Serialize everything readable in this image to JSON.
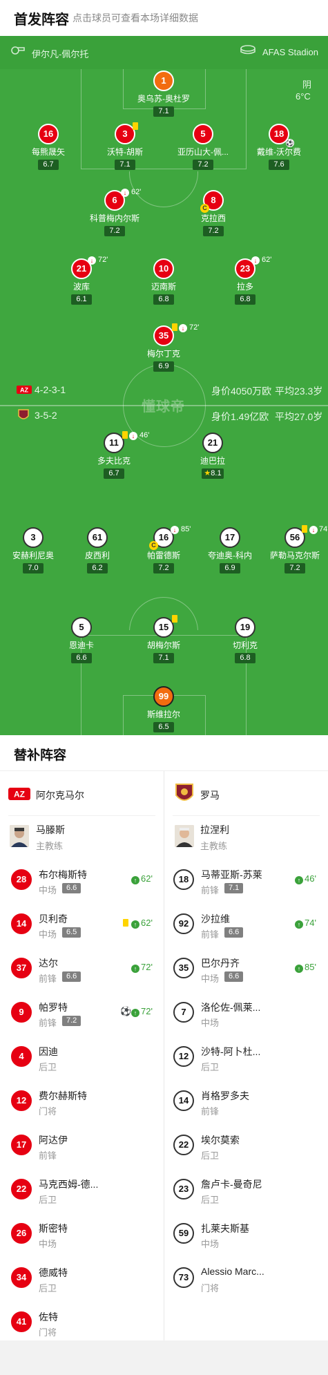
{
  "header": {
    "title": "首发阵容",
    "subtitle": "点击球员可查看本场详细数据"
  },
  "match": {
    "referee": "伊尔凡-佩尔托",
    "stadium": "AFAS Stadion",
    "weather": "阴",
    "temperature": "6°C"
  },
  "home": {
    "formation": "4-2-3-1",
    "value": "身价4050万欧",
    "avg_age": "平均23.3岁"
  },
  "away": {
    "formation": "3-5-2",
    "value": "身价1.49亿欧",
    "avg_age": "平均27.0岁"
  },
  "watermark": "懂球帝",
  "home_players": [
    {
      "num": "1",
      "name": "奥乌苏-奥杜罗",
      "rating": "7.1"
    },
    {
      "num": "16",
      "name": "每熊晟矢",
      "rating": "6.7"
    },
    {
      "num": "3",
      "name": "沃特-胡斯",
      "rating": "7.1"
    },
    {
      "num": "5",
      "name": "亚历山大-佩...",
      "rating": "7.2"
    },
    {
      "num": "18",
      "name": "戴维-沃尔费",
      "rating": "7.6"
    },
    {
      "num": "6",
      "name": "科普梅内尔斯",
      "rating": "7.2",
      "sub": "62'"
    },
    {
      "num": "8",
      "name": "克拉西",
      "rating": "7.2"
    },
    {
      "num": "21",
      "name": "波库",
      "rating": "6.1",
      "sub": "72'"
    },
    {
      "num": "10",
      "name": "迈南斯",
      "rating": "6.8"
    },
    {
      "num": "23",
      "name": "拉多",
      "rating": "6.8",
      "sub": "62'"
    },
    {
      "num": "35",
      "name": "梅尔丁克",
      "rating": "6.9",
      "sub": "72'"
    }
  ],
  "away_players": [
    {
      "num": "11",
      "name": "多夫比克",
      "rating": "6.7",
      "sub": "46'"
    },
    {
      "num": "21",
      "name": "迪巴拉",
      "rating": "8.1"
    },
    {
      "num": "3",
      "name": "安赫利尼奥",
      "rating": "7.0"
    },
    {
      "num": "61",
      "name": "皮西利",
      "rating": "6.2"
    },
    {
      "num": "16",
      "name": "帕雷德斯",
      "rating": "7.2",
      "sub": "85'"
    },
    {
      "num": "17",
      "name": "夸迪奥-科内",
      "rating": "6.9"
    },
    {
      "num": "56",
      "name": "萨勒马克尔斯",
      "rating": "7.2",
      "sub": "74'"
    },
    {
      "num": "5",
      "name": "恩迪卡",
      "rating": "6.6"
    },
    {
      "num": "15",
      "name": "胡梅尔斯",
      "rating": "7.1"
    },
    {
      "num": "19",
      "name": "切利克",
      "rating": "6.8"
    },
    {
      "num": "99",
      "name": "斯维拉尔",
      "rating": "6.5"
    }
  ],
  "subs": {
    "title": "替补阵容",
    "home_team": "阿尔克马尔",
    "away_team": "罗马",
    "home_coach": {
      "name": "马滕斯",
      "role": "主教练"
    },
    "away_coach": {
      "name": "拉涅利",
      "role": "主教练"
    },
    "home_list": [
      {
        "num": "28",
        "name": "布尔梅斯特",
        "pos": "中场",
        "rating": "6.6",
        "sub": "62'"
      },
      {
        "num": "14",
        "name": "贝利奇",
        "pos": "中场",
        "rating": "6.5",
        "sub": "62'"
      },
      {
        "num": "37",
        "name": "达尔",
        "pos": "前锋",
        "rating": "6.6",
        "sub": "72'"
      },
      {
        "num": "9",
        "name": "帕罗特",
        "pos": "前锋",
        "rating": "7.2",
        "sub": "72'"
      },
      {
        "num": "4",
        "name": "因迪",
        "pos": "后卫"
      },
      {
        "num": "12",
        "name": "费尔赫斯特",
        "pos": "门将"
      },
      {
        "num": "17",
        "name": "阿达伊",
        "pos": "前锋"
      },
      {
        "num": "22",
        "name": "马克西姆-德...",
        "pos": "后卫"
      },
      {
        "num": "26",
        "name": "斯密特",
        "pos": "中场"
      },
      {
        "num": "34",
        "name": "德威特",
        "pos": "后卫"
      },
      {
        "num": "41",
        "name": "佐特",
        "pos": "门将"
      }
    ],
    "away_list": [
      {
        "num": "18",
        "name": "马蒂亚斯-苏莱",
        "pos": "前锋",
        "rating": "7.1",
        "sub": "46'"
      },
      {
        "num": "92",
        "name": "沙拉维",
        "pos": "前锋",
        "rating": "6.6",
        "sub": "74'"
      },
      {
        "num": "35",
        "name": "巴尔丹齐",
        "pos": "中场",
        "rating": "6.6",
        "sub": "85'"
      },
      {
        "num": "7",
        "name": "洛伦佐-佩莱...",
        "pos": "中场"
      },
      {
        "num": "12",
        "name": "沙特-阿卜杜...",
        "pos": "后卫"
      },
      {
        "num": "14",
        "name": "肖格罗多夫",
        "pos": "前锋"
      },
      {
        "num": "22",
        "name": "埃尔莫索",
        "pos": "后卫"
      },
      {
        "num": "23",
        "name": "詹卢卡-曼奇尼",
        "pos": "后卫"
      },
      {
        "num": "59",
        "name": "扎莱夫斯基",
        "pos": "中场"
      },
      {
        "num": "73",
        "name": "Alessio Marc...",
        "pos": "门将"
      }
    ]
  }
}
